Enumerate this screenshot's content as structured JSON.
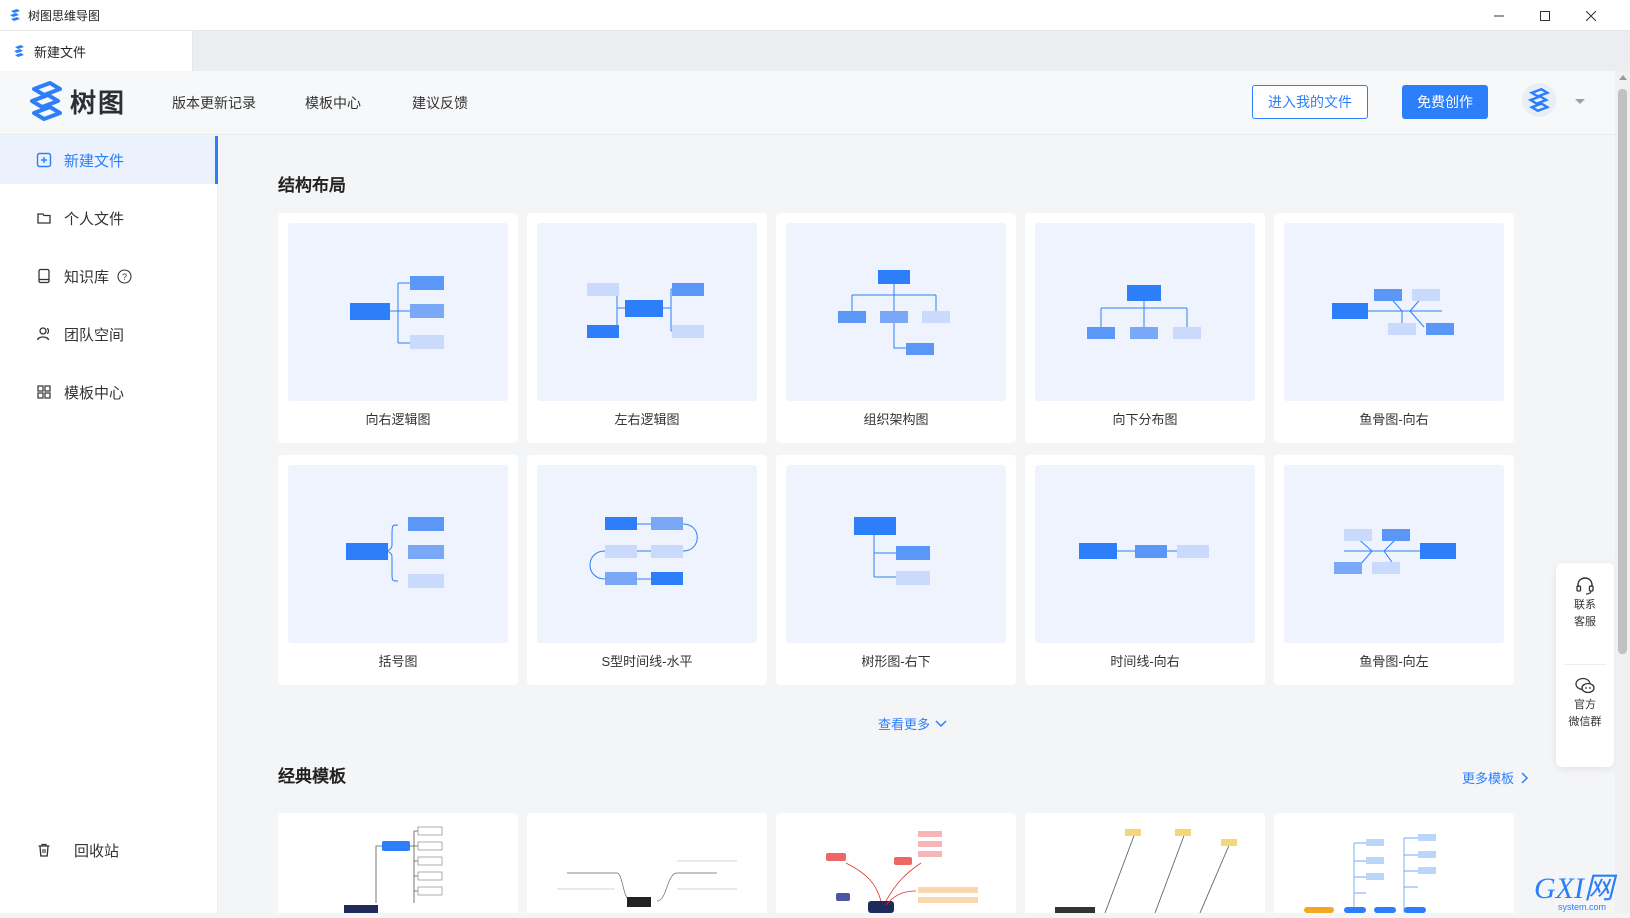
{
  "window": {
    "title": "树图思维导图",
    "minimize_icon": "minimize-icon",
    "maximize_icon": "maximize-icon",
    "close_icon": "close-icon"
  },
  "tabs": [
    {
      "label": "新建文件"
    }
  ],
  "header": {
    "brand": "树图",
    "nav": [
      "版本更新记录",
      "模板中心",
      "建议反馈"
    ],
    "enter_files": "进入我的文件",
    "create_free": "免费创作"
  },
  "sidebar": {
    "items": [
      {
        "label": "新建文件",
        "icon": "new-file-icon"
      },
      {
        "label": "个人文件",
        "icon": "folder-icon"
      },
      {
        "label": "知识库",
        "icon": "book-icon"
      },
      {
        "label": "团队空间",
        "icon": "team-icon"
      },
      {
        "label": "模板中心",
        "icon": "grid-icon"
      }
    ],
    "trash": "回收站"
  },
  "layouts": {
    "title": "结构布局",
    "items": [
      "向右逻辑图",
      "左右逻辑图",
      "组织架构图",
      "向下分布图",
      "鱼骨图-向右",
      "括号图",
      "S型时间线-水平",
      "树形图-右下",
      "时间线-向右",
      "鱼骨图-向左"
    ],
    "see_more": "查看更多"
  },
  "templates": {
    "title": "经典模板",
    "more": "更多模板"
  },
  "float": {
    "contact": [
      "联系",
      "客服"
    ],
    "wechat": [
      "官方",
      "微信群"
    ]
  },
  "watermark": {
    "text": "GXI网",
    "sub": "system.com"
  },
  "colors": {
    "accent": "#2d7ff9",
    "node_dark": "#2d7ff9",
    "node_mid": "#79a8f7",
    "node_light": "#c9dafc"
  }
}
